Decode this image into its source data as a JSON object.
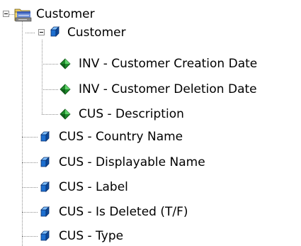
{
  "tree": {
    "root": {
      "label": "Customer",
      "icon": "folder-icon",
      "expanded": true
    },
    "class": {
      "label": "Customer",
      "icon": "cube-icon",
      "expanded": true
    },
    "class_children": [
      {
        "label": "INV - Customer Creation Date",
        "icon": "diamond-icon"
      },
      {
        "label": "INV - Customer Deletion Date",
        "icon": "diamond-icon"
      },
      {
        "label": "CUS - Description",
        "icon": "diamond-icon"
      }
    ],
    "root_children": [
      {
        "label": "CUS - Country Name",
        "icon": "cube-icon"
      },
      {
        "label": "CUS - Displayable Name",
        "icon": "cube-icon"
      },
      {
        "label": "CUS - Label",
        "icon": "cube-icon"
      },
      {
        "label": "CUS - Is Deleted (T/F)",
        "icon": "cube-icon"
      },
      {
        "label": "CUS - Type",
        "icon": "cube-icon"
      }
    ]
  }
}
